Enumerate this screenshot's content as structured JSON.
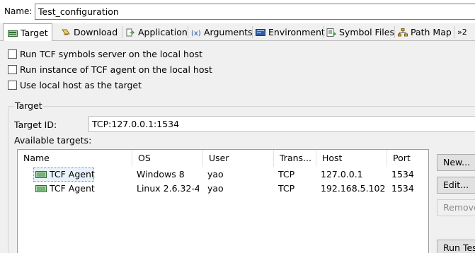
{
  "name": {
    "label": "Name:",
    "value": "Test_configuration"
  },
  "tabs": [
    {
      "label": "Target",
      "icon": "target-icon",
      "active": true
    },
    {
      "label": "Download",
      "icon": "download-icon"
    },
    {
      "label": "Application",
      "icon": "application-icon"
    },
    {
      "label": "Arguments",
      "icon": "arguments-icon"
    },
    {
      "label": "Environment",
      "icon": "environment-icon"
    },
    {
      "label": "Symbol Files",
      "icon": "symbol-files-icon"
    },
    {
      "label": "Path Map",
      "icon": "path-map-icon"
    },
    {
      "label": "»2",
      "icon": "more-tabs-icon"
    }
  ],
  "options": [
    {
      "label": "Run TCF symbols server on the local host",
      "checked": false
    },
    {
      "label": "Run instance of TCF agent on the local host",
      "checked": false
    },
    {
      "label": "Use local host as the target",
      "checked": false
    }
  ],
  "target": {
    "group_label": "Target",
    "id_label": "Target ID:",
    "id_value": "TCP:127.0.0.1:1534",
    "available_label": "Available targets:",
    "columns": [
      "Name",
      "OS",
      "User",
      "Trans...",
      "Host",
      "Port"
    ],
    "rows": [
      {
        "name": "TCF Agent",
        "os": "Windows 8",
        "user": "yao",
        "transport": "TCP",
        "host": "127.0.0.1",
        "port": "1534",
        "selected": true
      },
      {
        "name": "TCF Agent",
        "os": "Linux 2.6.32-4...",
        "user": "yao",
        "transport": "TCP",
        "host": "192.168.5.102",
        "port": "1534",
        "selected": false
      }
    ],
    "buttons": [
      {
        "label": "New...",
        "enabled": true
      },
      {
        "label": "Edit...",
        "enabled": true
      },
      {
        "label": "Remove",
        "enabled": false
      },
      {
        "label": "Run Test",
        "enabled": true
      }
    ]
  }
}
